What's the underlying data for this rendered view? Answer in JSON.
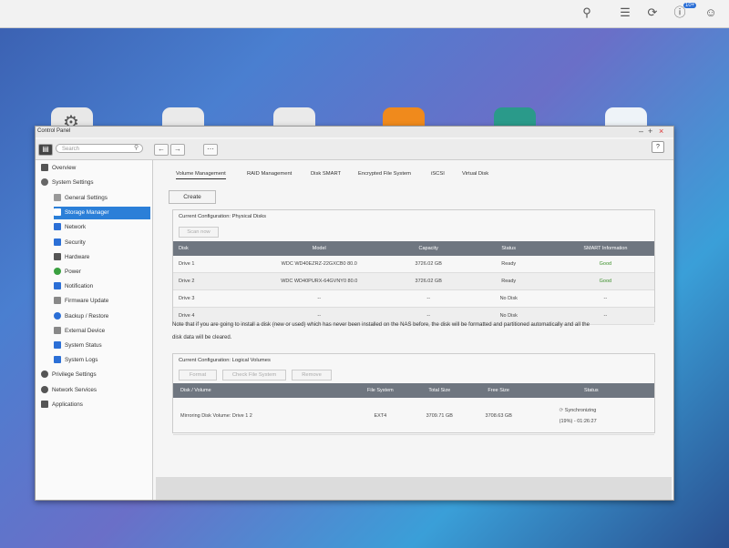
{
  "topbar": {
    "notification_count": "10+"
  },
  "window": {
    "title": "Control Panel",
    "search_placeholder": "Search",
    "help_label": "?"
  },
  "sidebar": {
    "items": [
      {
        "label": "Overview",
        "icon": "grid-icon",
        "color": "#555555"
      },
      {
        "label": "System Settings",
        "icon": "gear-icon",
        "color": "#555555"
      },
      {
        "label": "General Settings",
        "icon": "settings-icon",
        "color": "#777777"
      },
      {
        "label": "Storage Manager",
        "icon": "database-icon",
        "color": "#ffffff"
      },
      {
        "label": "Network",
        "icon": "network-icon",
        "color": "#2b6fd6"
      },
      {
        "label": "Security",
        "icon": "shield-icon",
        "color": "#2b6fd6"
      },
      {
        "label": "Hardware",
        "icon": "hardware-icon",
        "color": "#555555"
      },
      {
        "label": "Power",
        "icon": "bulb-icon",
        "color": "#3aa040"
      },
      {
        "label": "Notification",
        "icon": "bell-icon",
        "color": "#2b6fd6"
      },
      {
        "label": "Firmware Update",
        "icon": "firmware-icon",
        "color": "#777777"
      },
      {
        "label": "Backup / Restore",
        "icon": "backup-icon",
        "color": "#2b6fd6"
      },
      {
        "label": "External Device",
        "icon": "device-icon",
        "color": "#777777"
      },
      {
        "label": "System Status",
        "icon": "monitor-icon",
        "color": "#2b6fd6"
      },
      {
        "label": "System Logs",
        "icon": "log-icon",
        "color": "#2b6fd6"
      },
      {
        "label": "Privilege Settings",
        "icon": "user-icon",
        "color": "#555555"
      },
      {
        "label": "Network Services",
        "icon": "globe-icon",
        "color": "#555555"
      },
      {
        "label": "Applications",
        "icon": "apps-icon",
        "color": "#555555"
      }
    ]
  },
  "tabs": [
    "Volume Management",
    "RAID Management",
    "Disk SMART",
    "Encrypted File System",
    "iSCSI",
    "Virtual Disk"
  ],
  "create_label": "Create",
  "physical": {
    "title": "Current Configuration: Physical Disks",
    "scan_label": "Scan now",
    "headers": [
      "Disk",
      "Model",
      "Capacity",
      "Status",
      "SMART Information"
    ],
    "rows": [
      [
        "Drive 1",
        "WDC WD40EZRZ-22GXCB0 80.0",
        "3726.02 GB",
        "Ready",
        "Good"
      ],
      [
        "Drive 2",
        "WDC WD40PURX-64GVNY0 80.0",
        "3726.02 GB",
        "Ready",
        "Good"
      ],
      [
        "Drive 3",
        "--",
        "--",
        "No Disk",
        "--"
      ],
      [
        "Drive 4",
        "--",
        "--",
        "No Disk",
        "--"
      ]
    ]
  },
  "note_line1": "Note that if you are going to install a disk (new or used) which has never been installed on the NAS before, the disk will be formatted and partitioned automatically and all the",
  "note_line2": "disk data will be cleared.",
  "logical": {
    "title": "Current Configuration: Logical Volumes",
    "format_label": "Format",
    "check_label": "Check File System",
    "remove_label": "Remove",
    "headers": [
      "Disk / Volume",
      "File System",
      "Total Size",
      "Free Size",
      "Status"
    ],
    "row": {
      "volume": "Mirroring Disk Volume: Drive 1 2",
      "fs": "EXT4",
      "total": "3709.71 GB",
      "free": "3708.63 GB",
      "status": "Synchronizing",
      "progress": "(19%) - 01:26:27"
    }
  }
}
